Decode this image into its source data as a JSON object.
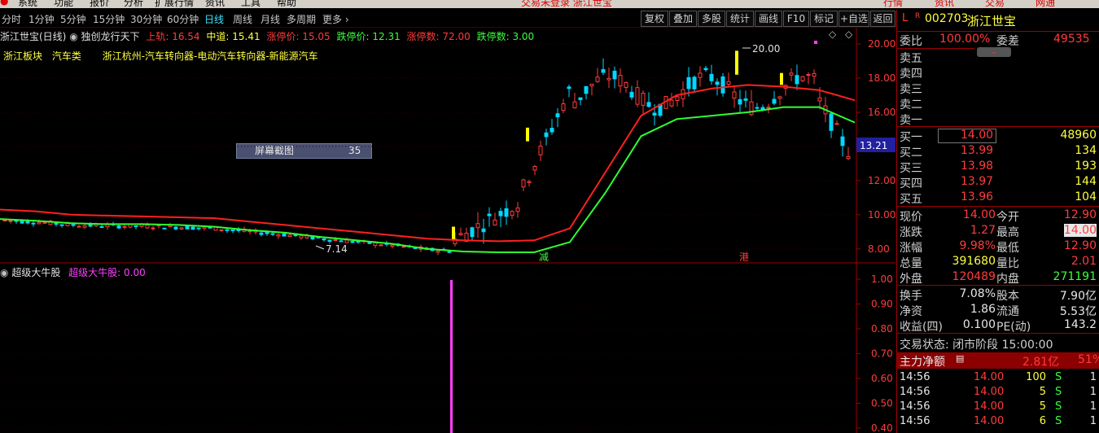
{
  "menu": {
    "items": [
      "系统",
      "功能",
      "报价",
      "分析",
      "扩展行情",
      "资讯",
      "工具",
      "帮助"
    ],
    "notice": "交易未登录  浙江世宝",
    "right_items": [
      "行情",
      "资讯",
      "交易",
      "网通"
    ]
  },
  "period_bar": {
    "periods": [
      "分时",
      "1分钟",
      "5分钟",
      "15分钟",
      "30分钟",
      "60分钟",
      "日线",
      "周线",
      "月线",
      "多周期",
      "更多 ›"
    ],
    "active": "日线",
    "tools": [
      "复权",
      "叠加",
      "多股",
      "统计",
      "画线",
      "F10",
      "标记",
      "+自选",
      "返回"
    ]
  },
  "chart_header": {
    "title": "浙江世宝(日线)",
    "indicator": "独创龙行天下",
    "upper": "上轨: 16.54",
    "middle": "中道: 15.41",
    "limit_up_price": "涨停价: 15.05",
    "limit_down_price": "跌停价: 12.31",
    "limit_up_count": "涨停数: 72.00",
    "limit_down_count": "跌停数: 3.00"
  },
  "sector_line": {
    "board": "浙江板块",
    "industry": "汽车类",
    "concepts": "浙江杭州-汽车转向器-电动汽车转向器-新能源汽车"
  },
  "screenshot_tag": {
    "label": "屏幕截图",
    "value": "35"
  },
  "annotations": {
    "high": "20.00",
    "low": "7.14",
    "mark1": "减",
    "mark2": "港",
    "current_price_tag": "13.21"
  },
  "sub_header": {
    "name": "超级大牛股",
    "series": "超级大牛股: 0.00"
  },
  "colors": {
    "up": "#ff3c3c",
    "down": "#00e0ff",
    "upper_line": "#ff2020",
    "lower_line": "#30ff30",
    "signal": "#ff40ff",
    "limit_bar": "#ffff00"
  },
  "right_panel": {
    "header": {
      "flag": "L",
      "r": "R",
      "code": "002703",
      "name": "浙江世宝"
    },
    "weibi": {
      "label": "委比",
      "value": "100.00%",
      "label2": "委差",
      "value2": "49535"
    },
    "asks": [
      {
        "label": "卖五",
        "price": "",
        "vol": ""
      },
      {
        "label": "卖四",
        "price": "",
        "vol": ""
      },
      {
        "label": "卖三",
        "price": "",
        "vol": ""
      },
      {
        "label": "卖二",
        "price": "",
        "vol": ""
      },
      {
        "label": "卖一",
        "price": "",
        "vol": ""
      }
    ],
    "bids": [
      {
        "label": "买一",
        "price": "14.00",
        "vol": "48960"
      },
      {
        "label": "买二",
        "price": "13.99",
        "vol": "134"
      },
      {
        "label": "买三",
        "price": "13.98",
        "vol": "193"
      },
      {
        "label": "买四",
        "price": "13.97",
        "vol": "144"
      },
      {
        "label": "买五",
        "price": "13.96",
        "vol": "104"
      }
    ],
    "stats": [
      {
        "l1": "现价",
        "v1": "14.00",
        "l2": "今开",
        "v2": "12.90"
      },
      {
        "l1": "涨跌",
        "v1": "1.27",
        "l2": "最高",
        "v2": "14.00"
      },
      {
        "l1": "涨幅",
        "v1": "9.98%",
        "l2": "最低",
        "v2": "12.90"
      },
      {
        "l1": "总量",
        "v1": "391680",
        "l2": "量比",
        "v2": "2.01"
      },
      {
        "l1": "外盘",
        "v1": "120489",
        "l2": "内盘",
        "v2": "271191"
      }
    ],
    "stats2": [
      {
        "l1": "换手",
        "v1": "7.08%",
        "l2": "股本",
        "v2": "7.90亿"
      },
      {
        "l1": "净资",
        "v1": "1.86",
        "l2": "流通",
        "v2": "5.53亿"
      },
      {
        "l1": "收益(四)",
        "v1": "0.100",
        "l2": "PE(动)",
        "v2": "143.2"
      }
    ],
    "status": "交易状态: 闭市阶段 15:00:00",
    "flow": {
      "label": "主力净额",
      "value": "2.81亿",
      "pct": "51%"
    },
    "ticks": [
      {
        "time": "14:56",
        "price": "14.00",
        "vol": "100",
        "side": "S",
        "n": "1"
      },
      {
        "time": "14:56",
        "price": "14.00",
        "vol": "5",
        "side": "S",
        "n": "1"
      },
      {
        "time": "14:56",
        "price": "14.00",
        "vol": "5",
        "side": "S",
        "n": "1"
      },
      {
        "time": "14:56",
        "price": "14.00",
        "vol": "6",
        "side": "S",
        "n": "1"
      }
    ]
  },
  "chart_data": {
    "type": "line",
    "title": "浙江世宝(日线)",
    "xlabel": "",
    "ylabel": "",
    "ylim": [
      7,
      21
    ],
    "y_ticks": [
      "20.00",
      "18.00",
      "16.00",
      "14.00",
      "12.00",
      "10.00",
      "8.00"
    ],
    "series": [
      {
        "name": "上轨",
        "values": [
          10.3,
          10.2,
          10.0,
          9.95,
          9.9,
          9.85,
          9.8,
          9.6,
          9.4,
          9.2,
          9.0,
          8.8,
          8.6,
          8.5,
          8.45,
          8.5,
          9.2,
          12.5,
          15.8,
          17.0,
          17.4,
          17.6,
          17.5,
          17.3,
          16.7
        ]
      },
      {
        "name": "中道",
        "values": [
          9.75,
          9.65,
          9.5,
          9.45,
          9.45,
          9.4,
          9.3,
          9.1,
          8.95,
          8.7,
          8.5,
          8.3,
          8.0,
          7.85,
          7.8,
          7.8,
          8.4,
          11.3,
          14.6,
          15.6,
          15.8,
          16.0,
          16.3,
          16.3,
          15.4
        ]
      }
    ],
    "sub_ylim": [
      0.4,
      1.0
    ],
    "sub_y_ticks": [
      "1.00",
      "0.90",
      "0.80",
      "0.70",
      "0.60",
      "0.50",
      "0.40"
    ]
  }
}
